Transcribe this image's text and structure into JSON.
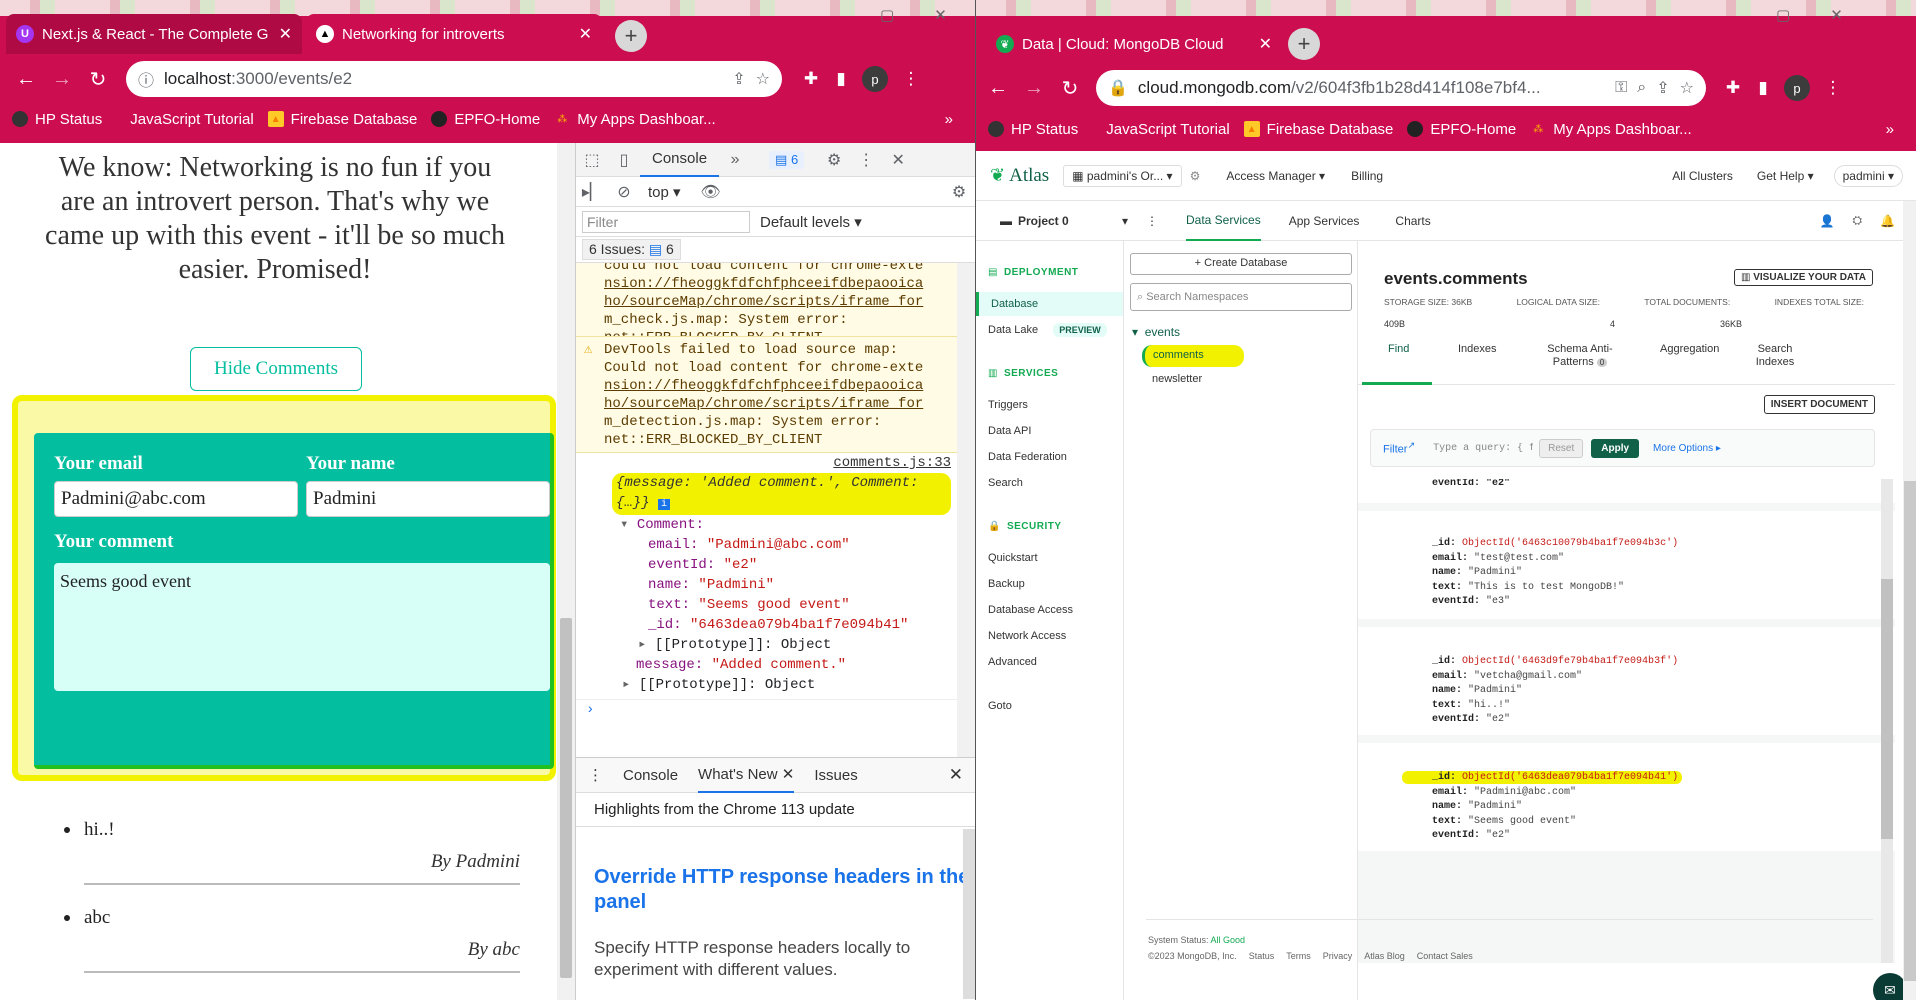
{
  "left_window": {
    "tabs": [
      {
        "title": "Next.js & React - The Complete G",
        "active": false,
        "icon": "udemy-icon"
      },
      {
        "title": "Networking for introverts",
        "active": true,
        "icon": "nextjs-icon"
      }
    ],
    "url": {
      "host": "localhost",
      "path": ":3000/events/e2"
    },
    "profile_initial": "p",
    "bookmarks": [
      "HP Status",
      "JavaScript Tutorial",
      "Firebase Database",
      "EPFO-Home",
      "My Apps Dashboar..."
    ],
    "page": {
      "intro": "We know: Networking is no fun if you are an introvert person. That's why we came up with this event - it'll be so much easier. Promised!",
      "hide_comments_label": "Hide Comments",
      "form": {
        "email_label": "Your email",
        "name_label": "Your name",
        "comment_label": "Your comment",
        "email_value": "Padmini@abc.com",
        "name_value": "Padmini",
        "comment_value": "Seems good event"
      },
      "comments": [
        {
          "text": "hi..!",
          "by": "By Padmini"
        },
        {
          "text": "abc",
          "by": "By abc"
        }
      ]
    },
    "devtools": {
      "tabs": [
        "Console"
      ],
      "issues_badge": "6",
      "context": "top",
      "filter_placeholder": "Filter",
      "levels": "Default levels",
      "issues_label": "6 Issues:",
      "issues_count": "6",
      "warnings": [
        {
          "lines": [
            "could not load content for chrome-exte",
            "nsion://fheoggkfdfchfphceeifdbepaooica",
            "ho/sourceMap/chrome/scripts/iframe_for",
            "m_check.js.map: System error:",
            "net::ERR_BLOCKED_BY_CLIENT"
          ]
        },
        {
          "lines": [
            "DevTools failed to load source map:",
            "Could not load content for chrome-exte",
            "nsion://fheoggkfdfchfphceeifdbepaooica",
            "ho/sourceMap/chrome/scripts/iframe_for",
            "m_detection.js.map: System error:",
            "net::ERR_BLOCKED_BY_CLIENT"
          ]
        }
      ],
      "log_source": "comments.js:33",
      "log_summary": "{message: 'Added comment.', Comment:",
      "log_summary2": "{…}}",
      "comment_key": "Comment:",
      "fields": [
        {
          "key": "email:",
          "value": "\"Padmini@abc.com\""
        },
        {
          "key": "eventId:",
          "value": "\"e2\""
        },
        {
          "key": "name:",
          "value": "\"Padmini\""
        },
        {
          "key": "text:",
          "value": "\"Seems good event\""
        },
        {
          "key": "_id:",
          "value": "\"6463dea079b4ba1f7e094b41\""
        }
      ],
      "proto1": "[[Prototype]]: Object",
      "message_key": "message:",
      "message_value": "\"Added comment.\"",
      "proto2": "[[Prototype]]: Object",
      "drawer_tabs": [
        "Console",
        "What's New",
        "Issues"
      ],
      "drawer_heading": "Highlights from the Chrome 113 update",
      "news_title": "Override HTTP response headers in the Network panel",
      "news_body": "Specify HTTP response headers locally to experiment with different values."
    }
  },
  "right_window": {
    "tab_title": "Data | Cloud: MongoDB Cloud",
    "url": {
      "host": "cloud.mongodb.com",
      "path": "/v2/604f3fb1b28d414f108e7bf4..."
    },
    "profile_initial": "p",
    "bookmarks": [
      "HP Status",
      "JavaScript Tutorial",
      "Firebase Database",
      "EPFO-Home",
      "My Apps Dashboar..."
    ],
    "atlas": {
      "logo": "Atlas",
      "org": "padmini's Or...",
      "top_links": [
        "Access Manager",
        "Billing"
      ],
      "top_right": [
        "All Clusters",
        "Get Help",
        "padmini"
      ],
      "project": "Project 0",
      "sub_tabs": [
        "Data Services",
        "App Services",
        "Charts"
      ],
      "sidebar": {
        "deployment_label": "DEPLOYMENT",
        "deployment_items": [
          "Database",
          "Data Lake"
        ],
        "preview_badge": "PREVIEW",
        "services_label": "SERVICES",
        "services_items": [
          "Triggers",
          "Data API",
          "Data Federation",
          "Search"
        ],
        "security_label": "SECURITY",
        "security_items": [
          "Quickstart",
          "Backup",
          "Database Access",
          "Network Access",
          "Advanced"
        ],
        "goto": "Goto"
      },
      "create_db": "+ Create Database",
      "search_ns": "Search Namespaces",
      "db_name": "events",
      "collections": [
        "comments",
        "newsletter"
      ],
      "collection_title": "events.comments",
      "visualize": "VISUALIZE YOUR DATA",
      "stats": [
        {
          "label": "STORAGE SIZE: 36KB",
          "value": "409B"
        },
        {
          "label": "LOGICAL DATA SIZE:",
          "value": ""
        },
        {
          "label": "TOTAL DOCUMENTS:",
          "value": "4"
        },
        {
          "label": "INDEXES TOTAL SIZE:",
          "value": "36KB"
        }
      ],
      "coll_tabs": [
        "Find",
        "Indexes",
        "Schema Anti-Patterns",
        "Aggregation",
        "Search Indexes"
      ],
      "schema_badge": "0",
      "insert_doc": "INSERT DOCUMENT",
      "filter_label": "Filter",
      "query_placeholder": "Type a query: { field",
      "reset": "Reset",
      "apply": "Apply",
      "more_options": "More Options",
      "partial_doc": "eventId: \"e2\"",
      "documents": [
        {
          "id": "ObjectId('6463c10079b4ba1f7e094b3c')",
          "email": "\"test@test.com\"",
          "name": "\"Padmini\"",
          "text": "\"This is to test MongoDB!\"",
          "eventId": "\"e3\""
        },
        {
          "id": "ObjectId('6463d9fe79b4ba1f7e094b3f')",
          "email": "\"vetcha@gmail.com\"",
          "name": "\"Padmini\"",
          "text": "\"hi..!\"",
          "eventId": "\"e2\""
        },
        {
          "id": "ObjectId('6463dea079b4ba1f7e094b41')",
          "email": "\"Padmini@abc.com\"",
          "name": "\"Padmini\"",
          "text": "\"Seems good event\"",
          "eventId": "\"e2\""
        }
      ],
      "doc_keys": [
        "_id:",
        "email:",
        "name:",
        "text:",
        "eventId:"
      ],
      "footer_status_label": "System Status:",
      "footer_status_value": "All Good",
      "footer_links": [
        "©2023 MongoDB, Inc.",
        "Status",
        "Terms",
        "Privacy",
        "Atlas Blog",
        "Contact Sales"
      ]
    }
  }
}
